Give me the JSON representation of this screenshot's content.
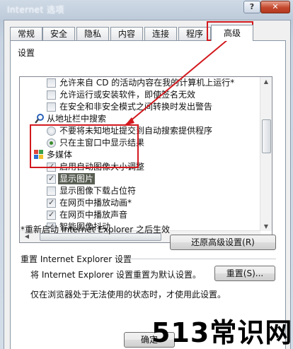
{
  "window": {
    "title": "Internet 选项",
    "help_label": "?",
    "close_label": "✕"
  },
  "tabs": [
    {
      "label": "常规"
    },
    {
      "label": "安全"
    },
    {
      "label": "隐私"
    },
    {
      "label": "内容"
    },
    {
      "label": "连接"
    },
    {
      "label": "程序"
    },
    {
      "label": "高级"
    }
  ],
  "settings_label": "设置",
  "settings_list": [
    {
      "type": "checkbox",
      "checked": false,
      "label": "允许来自 CD 的活动内容在我的计算机上运行*"
    },
    {
      "type": "checkbox",
      "checked": false,
      "label": "允许运行或安装软件，即使签名无效"
    },
    {
      "type": "checkbox",
      "checked": false,
      "label": "在安全和非安全模式之间转换时发出警告"
    },
    {
      "type": "group",
      "icon": "search-icon",
      "label": "从地址栏中搜索"
    },
    {
      "type": "radio",
      "checked": false,
      "label": "不要将未知地址提交到自动搜索提供程序"
    },
    {
      "type": "radio",
      "checked": true,
      "label": "只在主窗口中显示结果"
    },
    {
      "type": "group",
      "icon": "multimedia-icon",
      "label": "多媒体"
    },
    {
      "type": "checkbox",
      "checked": true,
      "label": "启用自动图像大小调整"
    },
    {
      "type": "checkbox",
      "checked": true,
      "label": "显示图片",
      "selected": true
    },
    {
      "type": "checkbox",
      "checked": false,
      "label": "显示图像下载占位符"
    },
    {
      "type": "checkbox",
      "checked": true,
      "label": "在网页中播放动画*"
    },
    {
      "type": "checkbox",
      "checked": true,
      "label": "在网页中播放声音"
    },
    {
      "type": "checkbox",
      "checked": true,
      "label": "智能图像抖动"
    }
  ],
  "restart_note": "*重新启动 Internet Explorer 之后生效",
  "restore_advanced_button": "还原高级设置(R)",
  "reset_section_title": "重置 Internet Explorer 设置",
  "reset_description": "将 Internet Explorer 设置重置为默认设置。",
  "reset_button": "重置(S)...",
  "reset_note": "仅在浏览器处于无法使用的状态时，才使用此设置。",
  "ok_button": "确定",
  "watermark": "513常识网",
  "colors": {
    "annotation_red": "#d2191e"
  }
}
